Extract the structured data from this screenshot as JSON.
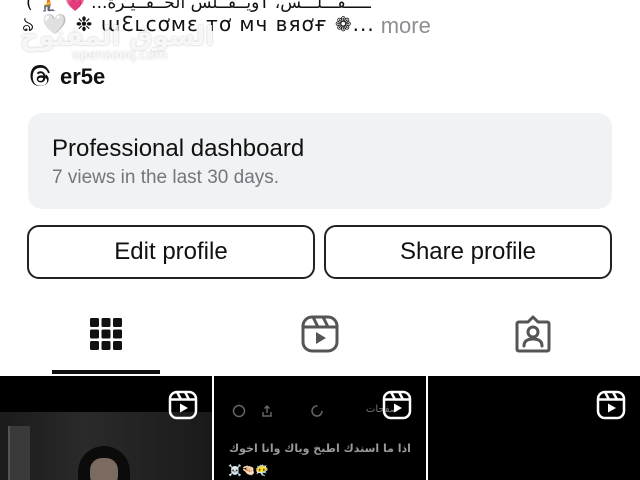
{
  "bio": {
    "line1": "( 🧎 💗 ...ـــــقـــلـــس، ٲويــقــلس الحــقــيـرة ّ ",
    "line2": "ঌ 🤍 ❉  ɯƐʟcơмɛ тơ мч вяơғ ❁...",
    "more": "more"
  },
  "watermark": {
    "ar": "السوق المفتوح",
    "en": "opensooq.com"
  },
  "threads": {
    "icon": "threads-icon",
    "handle": "er5e"
  },
  "dashboard": {
    "title": "Professional dashboard",
    "subtitle": "7 views in the last 30 days."
  },
  "buttons": {
    "edit": "Edit profile",
    "share": "Share profile"
  },
  "tabs": [
    {
      "name": "grid",
      "icon": "grid-icon",
      "selected": true
    },
    {
      "name": "reels",
      "icon": "reels-icon",
      "selected": false
    },
    {
      "name": "tagged",
      "icon": "tagged-person-icon",
      "selected": false
    }
  ],
  "grid": {
    "cell2_text": "اذا ما اسندك اطبخ وياك وانا اخوك",
    "cell2_side": "صفحات",
    "cell2_emoji": "☠️🤏🏻😶‍🌫️"
  },
  "colors": {
    "background": "#ffffff",
    "dashboard_bg": "#f1f2f4",
    "muted_text": "#73767c",
    "more_text": "#8e8e93"
  }
}
